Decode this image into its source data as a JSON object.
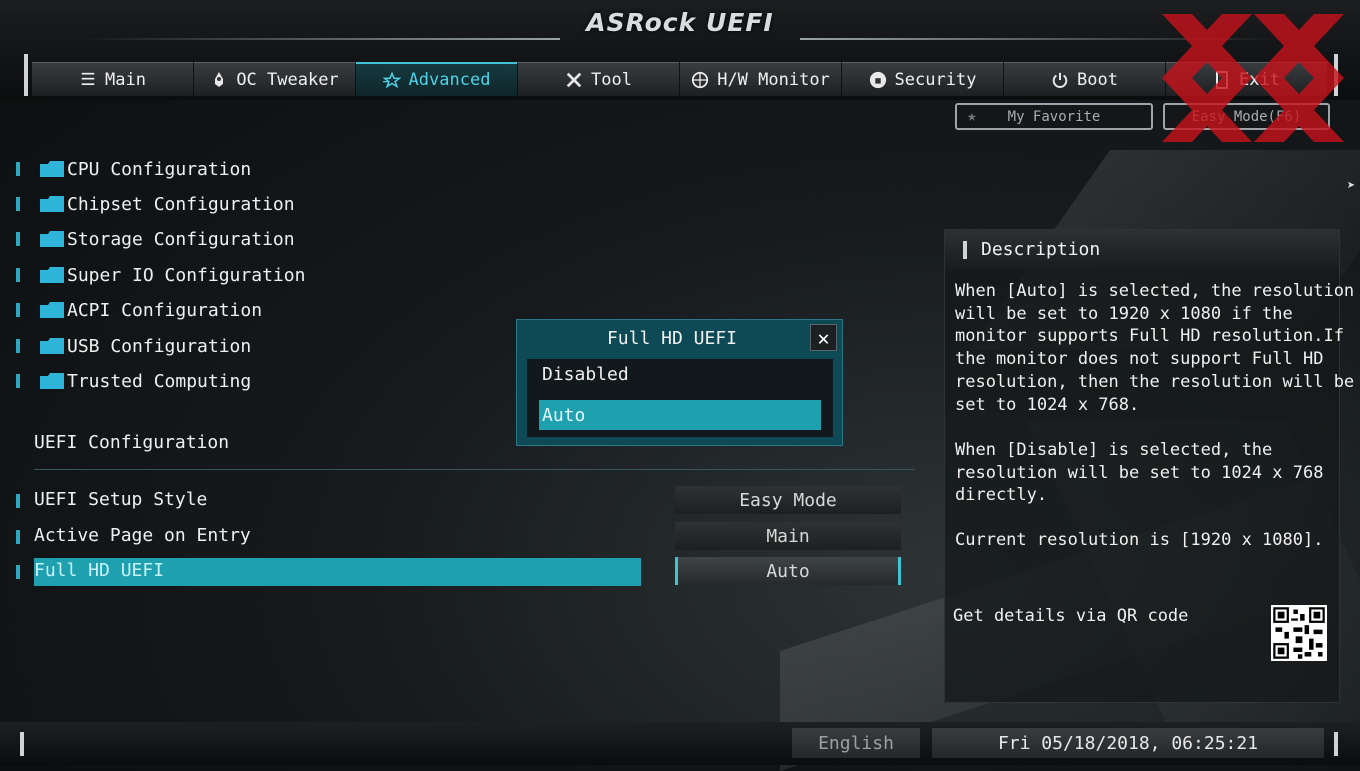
{
  "header": {
    "logo": "ASRock UEFI",
    "tabs": [
      {
        "label": "Main",
        "icon": "list-icon"
      },
      {
        "label": "OC Tweaker",
        "icon": "rocket-icon"
      },
      {
        "label": "Advanced",
        "icon": "star-icon"
      },
      {
        "label": "Tool",
        "icon": "wrench-icon"
      },
      {
        "label": "H/W Monitor",
        "icon": "monitor-icon"
      },
      {
        "label": "Security",
        "icon": "shield-icon"
      },
      {
        "label": "Boot",
        "icon": "power-icon"
      },
      {
        "label": "Exit",
        "icon": "exit-icon"
      }
    ],
    "active_tab": "Advanced",
    "my_favorite": "My Favorite",
    "easy_mode": "Easy Mode(F6)"
  },
  "menu": {
    "items": [
      "CPU Configuration",
      "Chipset Configuration",
      "Storage Configuration",
      "Super IO Configuration",
      "ACPI Configuration",
      "USB Configuration",
      "Trusted Computing"
    ]
  },
  "uefi_config": {
    "title": "UEFI Configuration",
    "options": [
      {
        "label": "UEFI Setup Style",
        "value": "Easy Mode"
      },
      {
        "label": "Active Page on Entry",
        "value": "Main"
      },
      {
        "label": "Full HD UEFI",
        "value": "Auto"
      }
    ]
  },
  "popup": {
    "title": "Full HD UEFI",
    "options": [
      "Disabled",
      "Auto"
    ],
    "selected": "Auto"
  },
  "description": {
    "title": "Description",
    "para1": "When [Auto] is selected, the resolution\nwill be set to 1920 x 1080 if the\nmonitor supports Full HD resolution.If\nthe monitor does not support Full HD\nresolution, then the resolution will be\nset to 1024 x 768.",
    "para2": "When [Disable] is selected, the\nresolution will be set to 1024 x 768\ndirectly.",
    "para3": "Current resolution is [1920 x 1080].",
    "qr_label": "Get details via QR code"
  },
  "footer": {
    "language": "English",
    "datetime": "Fri 05/18/2018, 06:25:21"
  },
  "colors": {
    "accent": "#1ea0ae",
    "active_tab_text": "#4fd2e6",
    "marker": "#2fa7c0"
  }
}
